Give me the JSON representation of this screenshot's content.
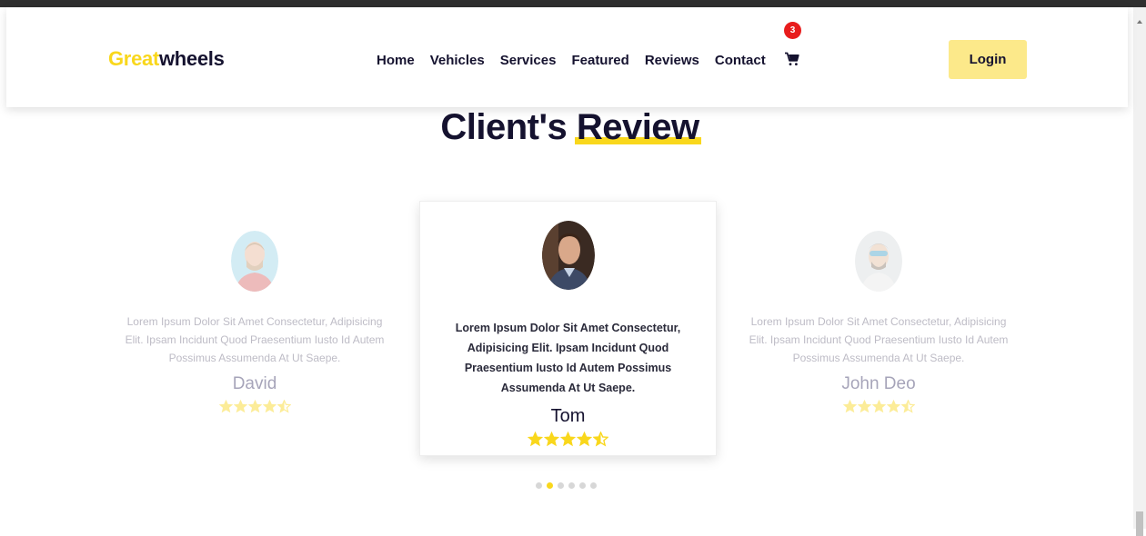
{
  "header": {
    "logo": {
      "accent": "Great",
      "rest": "wheels"
    },
    "nav": [
      "Home",
      "Vehicles",
      "Services",
      "Featured",
      "Reviews",
      "Contact"
    ],
    "cart": {
      "icon": "cart-icon",
      "badge_count": "3"
    },
    "login_label": "Login"
  },
  "section": {
    "title_start": "Client's ",
    "title_highlight": "Review"
  },
  "reviews": [
    {
      "text": "Lorem Ipsum Dolor Sit Amet Consectetur, Adipisicing Elit. Ipsam Incidunt Quod Praesentium Iusto Id Autem Possimus Assumenda At Ut Saepe.",
      "name": "David",
      "rating": 4.5
    },
    {
      "text": "Lorem Ipsum Dolor Sit Amet Consectetur, Adipisicing Elit. Ipsam Incidunt Quod Praesentium Iusto Id Autem Possimus Assumenda At Ut Saepe.",
      "name": "Tom",
      "rating": 4.5
    },
    {
      "text": "Lorem Ipsum Dolor Sit Amet Consectetur, Adipisicing Elit. Ipsam Incidunt Quod Praesentium Iusto Id Autem Possimus Assumenda At Ut Saepe.",
      "name": "John Deo",
      "rating": 4.5
    }
  ],
  "slider": {
    "dot_count": 6,
    "active_index": 1
  },
  "colors": {
    "accent": "#f9d71c",
    "dark": "#15122f",
    "badge": "#e81c1c",
    "login_bg": "#fce98a"
  }
}
